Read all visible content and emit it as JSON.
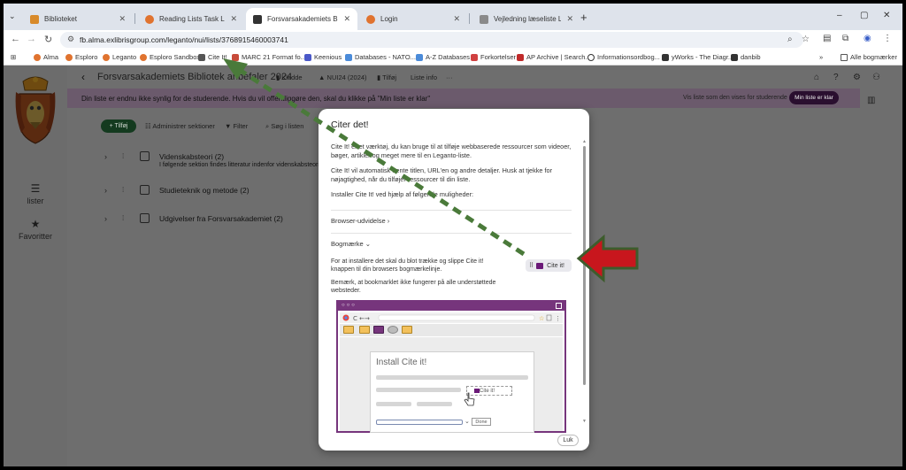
{
  "browser": {
    "tabs": [
      {
        "title": "Biblioteket",
        "favicon_color": "#d88a2a"
      },
      {
        "title": "Reading Lists Task List",
        "favicon_color": "#e0732f"
      },
      {
        "title": "Forsvarsakademiets Bibliotek a",
        "favicon_color": "#333333",
        "active": true
      },
      {
        "title": "Login",
        "favicon_color": "#e0732f"
      },
      {
        "title": "Vejledning læseliste Leganto",
        "favicon_color": "#8a8a8a"
      }
    ],
    "new_tab": "+",
    "window_controls": {
      "minimize": "–",
      "restore": "▢",
      "close": "✕"
    },
    "url": "fb.alma.exlibrisgroup.com/leganto/nui/lists/3768915460003741",
    "bookmarks": [
      {
        "label": "Alma",
        "color": "#e0732f"
      },
      {
        "label": "Esploro",
        "color": "#e0732f"
      },
      {
        "label": "Leganto",
        "color": "#e0732f"
      },
      {
        "label": "Esploro Sandbox",
        "color": "#e0732f"
      },
      {
        "label": "Cite It!",
        "color": "#555555"
      },
      {
        "label": "MARC 21 Format fo...",
        "color": "#c84b3a"
      },
      {
        "label": "Keenious",
        "color": "#4a58c8"
      },
      {
        "label": "Databases - NATO...",
        "color": "#4b8bd9"
      },
      {
        "label": "A-Z Databases",
        "color": "#4b8bd9"
      },
      {
        "label": "Forkortelser",
        "color": "#d04040"
      },
      {
        "label": "AP Archive | Search...",
        "color": "#c02a2a"
      },
      {
        "label": "Informationsordbog...",
        "color": "#333333"
      },
      {
        "label": "yWorks - The Diagr...",
        "color": "#333333"
      },
      {
        "label": "danbib",
        "color": "#333333"
      }
    ],
    "bookmarks_more": "»",
    "all_bookmarks": "Alle bogmærker"
  },
  "sidebar": {
    "items": [
      {
        "label": "lister",
        "icon": "list-icon"
      },
      {
        "label": "Favoritter",
        "icon": "star-icon"
      }
    ]
  },
  "list_header": {
    "back": "‹",
    "title": "Forsvarsakademiets Bibliotek anbefaler 2024",
    "status": "Kladde",
    "course": "NUI24 (2024)",
    "add": "Tilføj",
    "info": "Liste info",
    "more": "···"
  },
  "notice": {
    "text": "Din liste er endnu ikke synlig for de studerende. Hvis du vil offentliggøre den, skal du klikke på \"Min liste er klar\"",
    "view_link": "Vis liste som den vises for studerende",
    "ready_button": "Min liste er klar"
  },
  "actions": {
    "add": "+ Tilføj",
    "manage": "Administrer sektioner",
    "filter": "Filter",
    "search": "Søg i listen"
  },
  "sections": [
    {
      "title": "Videnskabsteori",
      "count": "(2)",
      "subtitle": "I følgende sektion findes litteratur indenfor videnskabsteori."
    },
    {
      "title": "Studieteknik og metode",
      "count": "(2)",
      "subtitle": ""
    },
    {
      "title": "Udgivelser fra Forsvarsakademiet",
      "count": "(2)",
      "subtitle": ""
    }
  ],
  "modal": {
    "title": "Citer det!",
    "paragraphs": [
      "Cite It! er et værktøj, du kan bruge til at tilføje webbaserede ressourcer som videoer, bøger, artikler og meget mere til en Leganto-liste.",
      "Cite It! vil automatisk hente titlen, URL'en og andre detaljer. Husk at tjekke for nøjagtighed, når du tilføjer ressourcer til din liste.",
      "Installer Cite It! ved hjælp af følgende muligheder:"
    ],
    "browser_ext": "Browser-udvidelse",
    "bookmark": "Bogmærke",
    "bookmark_text": "For at installere det skal du blot trække og slippe Cite it! knappen til din browsers bogmærkelinje.",
    "note": "Bemærk, at bookmarklet ikke fungerer på alle understøttede websteder.",
    "cite_button": "Cite it!",
    "illustration_title": "Install Cite it!",
    "illustration_chip": "Cite it!",
    "illustration_done": "Done",
    "close": "Luk"
  },
  "colors": {
    "accent": "#3a1040",
    "arrow_green": "#4a7a3a",
    "arrow_red": "#c8161d"
  }
}
